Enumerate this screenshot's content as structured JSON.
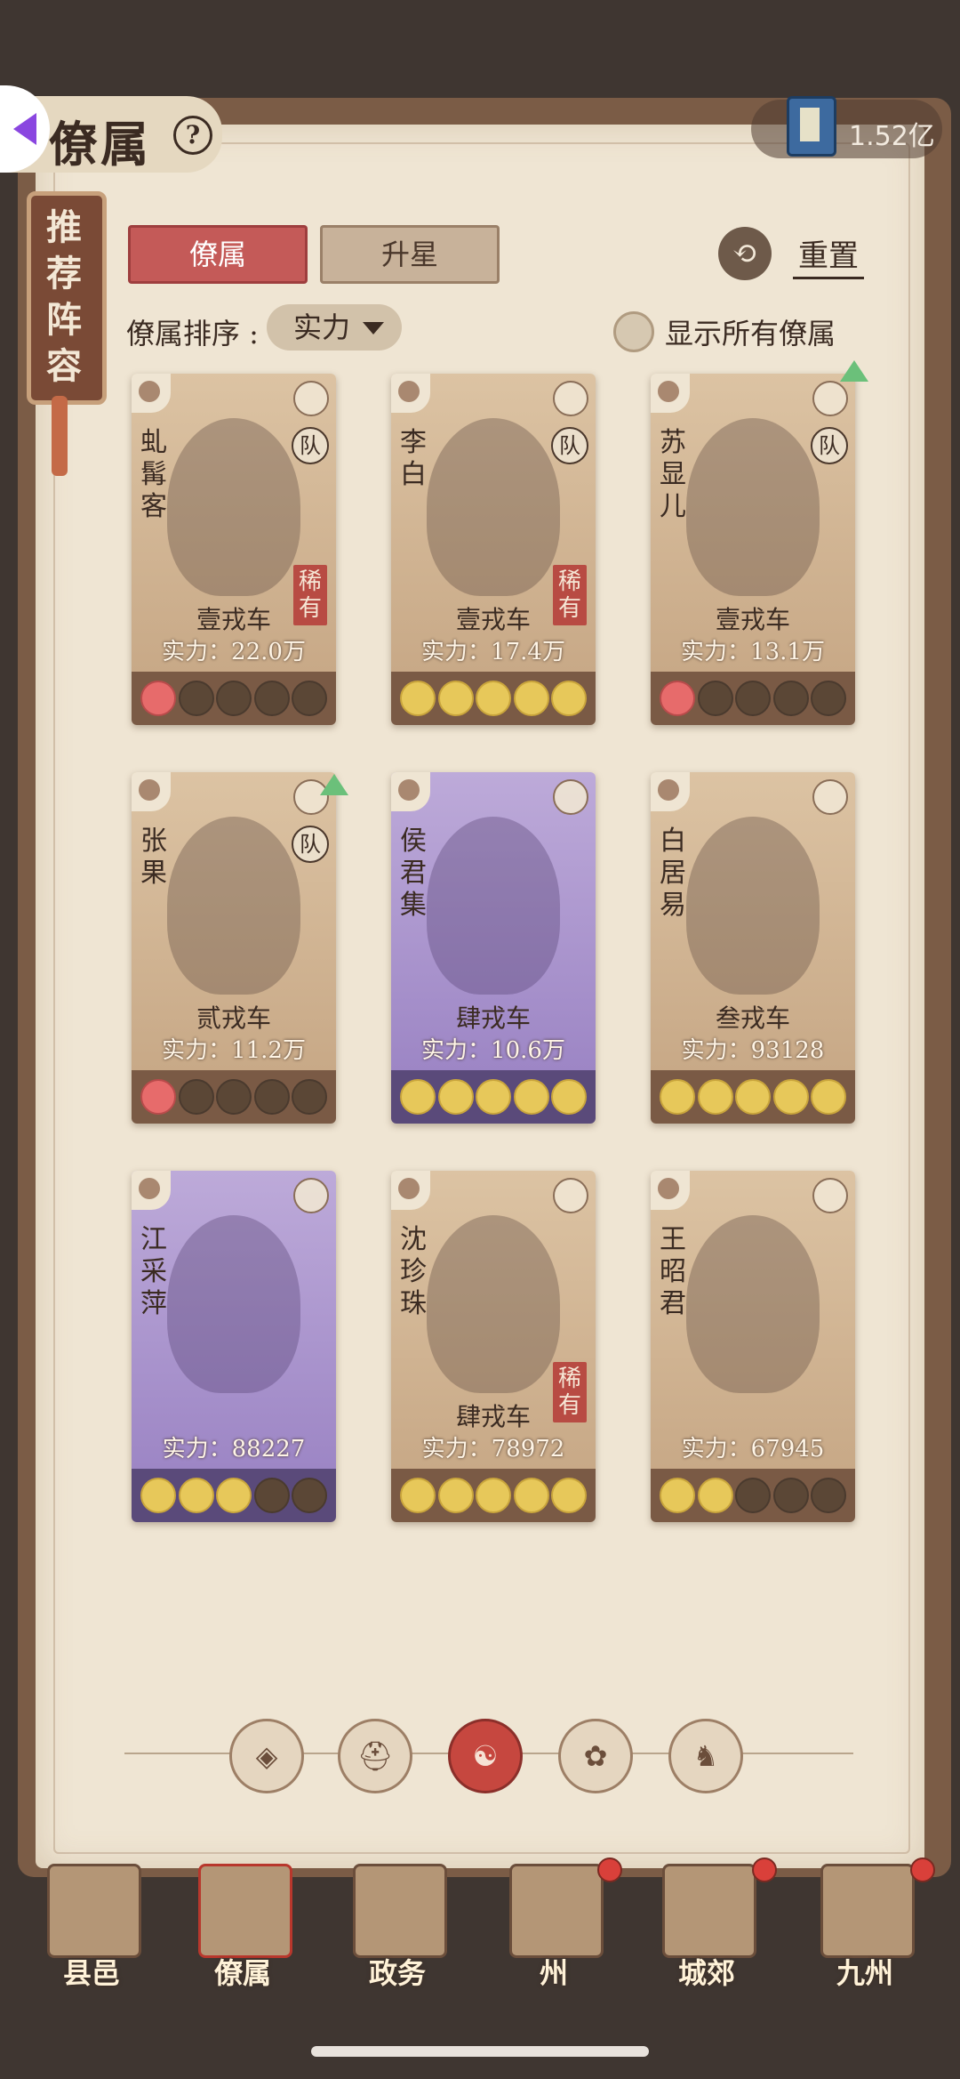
{
  "header": {
    "title": "僚属",
    "help_icon": "?",
    "currency_value": "1.52亿"
  },
  "side_scroll": {
    "label": "推荐阵容"
  },
  "tabs": [
    {
      "label": "僚属",
      "active": true
    },
    {
      "label": "升星",
      "active": false
    }
  ],
  "reset": {
    "label": "重置"
  },
  "sort": {
    "label": "僚属排序 :",
    "selected": "实力"
  },
  "show_all": {
    "label": "显示所有僚属",
    "checked": false
  },
  "cards": [
    {
      "name": "虬髯客",
      "rank": "壹戎车",
      "power": "实力：22.0万",
      "rare": "稀有",
      "team": "队",
      "style": "normal",
      "moons": [
        "red",
        "empty",
        "empty",
        "empty",
        "empty"
      ]
    },
    {
      "name": "李白",
      "rank": "壹戎车",
      "power": "实力：17.4万",
      "rare": "稀有",
      "team": "队",
      "style": "normal",
      "moons": [
        "gold",
        "gold",
        "gold",
        "gold",
        "gold"
      ]
    },
    {
      "name": "苏显儿",
      "rank": "壹戎车",
      "power": "实力：13.1万",
      "rare": "",
      "team": "队",
      "style": "normal",
      "moons": [
        "red",
        "empty",
        "empty",
        "empty",
        "empty"
      ]
    },
    {
      "name": "张果",
      "rank": "贰戎车",
      "power": "实力：11.2万",
      "rare": "",
      "team": "队",
      "style": "normal",
      "moons": [
        "red",
        "empty",
        "empty",
        "empty",
        "empty"
      ]
    },
    {
      "name": "侯君集",
      "rank": "肆戎车",
      "power": "实力：10.6万",
      "rare": "",
      "team": "",
      "style": "purple",
      "moons": [
        "gold",
        "gold",
        "gold",
        "gold",
        "gold"
      ]
    },
    {
      "name": "白居易",
      "rank": "叁戎车",
      "power": "实力：93128",
      "rare": "",
      "team": "",
      "style": "normal",
      "moons": [
        "gold",
        "gold",
        "gold",
        "gold",
        "gold"
      ]
    },
    {
      "name": "江采萍",
      "rank": "",
      "power": "实力：88227",
      "rare": "",
      "team": "",
      "style": "purple",
      "moons": [
        "gold",
        "gold",
        "gold",
        "empty",
        "empty"
      ]
    },
    {
      "name": "沈珍珠",
      "rank": "肆戎车",
      "power": "实力：78972",
      "rare": "稀有",
      "team": "",
      "style": "normal",
      "moons": [
        "gold",
        "gold",
        "gold",
        "gold",
        "gold"
      ]
    },
    {
      "name": "王昭君",
      "rank": "",
      "power": "实力：67945",
      "rare": "",
      "team": "",
      "style": "normal",
      "moons": [
        "gold",
        "gold",
        "empty",
        "empty",
        "empty"
      ]
    }
  ],
  "filters": [
    {
      "icon": "diamond-icon",
      "glyph": "◈",
      "active": false
    },
    {
      "icon": "helmet-icon",
      "glyph": "⛑",
      "active": false
    },
    {
      "icon": "gourd-icon",
      "glyph": "☯",
      "active": true
    },
    {
      "icon": "fan-icon",
      "glyph": "✿",
      "active": false
    },
    {
      "icon": "animal-icon",
      "glyph": "♞",
      "active": false
    }
  ],
  "nav": [
    {
      "label": "县邑",
      "badge": false,
      "active": false
    },
    {
      "label": "僚属",
      "badge": false,
      "active": true
    },
    {
      "label": "政务",
      "badge": false,
      "active": false
    },
    {
      "label": "州",
      "badge": true,
      "active": false
    },
    {
      "label": "城郊",
      "badge": true,
      "active": false
    },
    {
      "label": "九州",
      "badge": true,
      "active": false
    }
  ]
}
